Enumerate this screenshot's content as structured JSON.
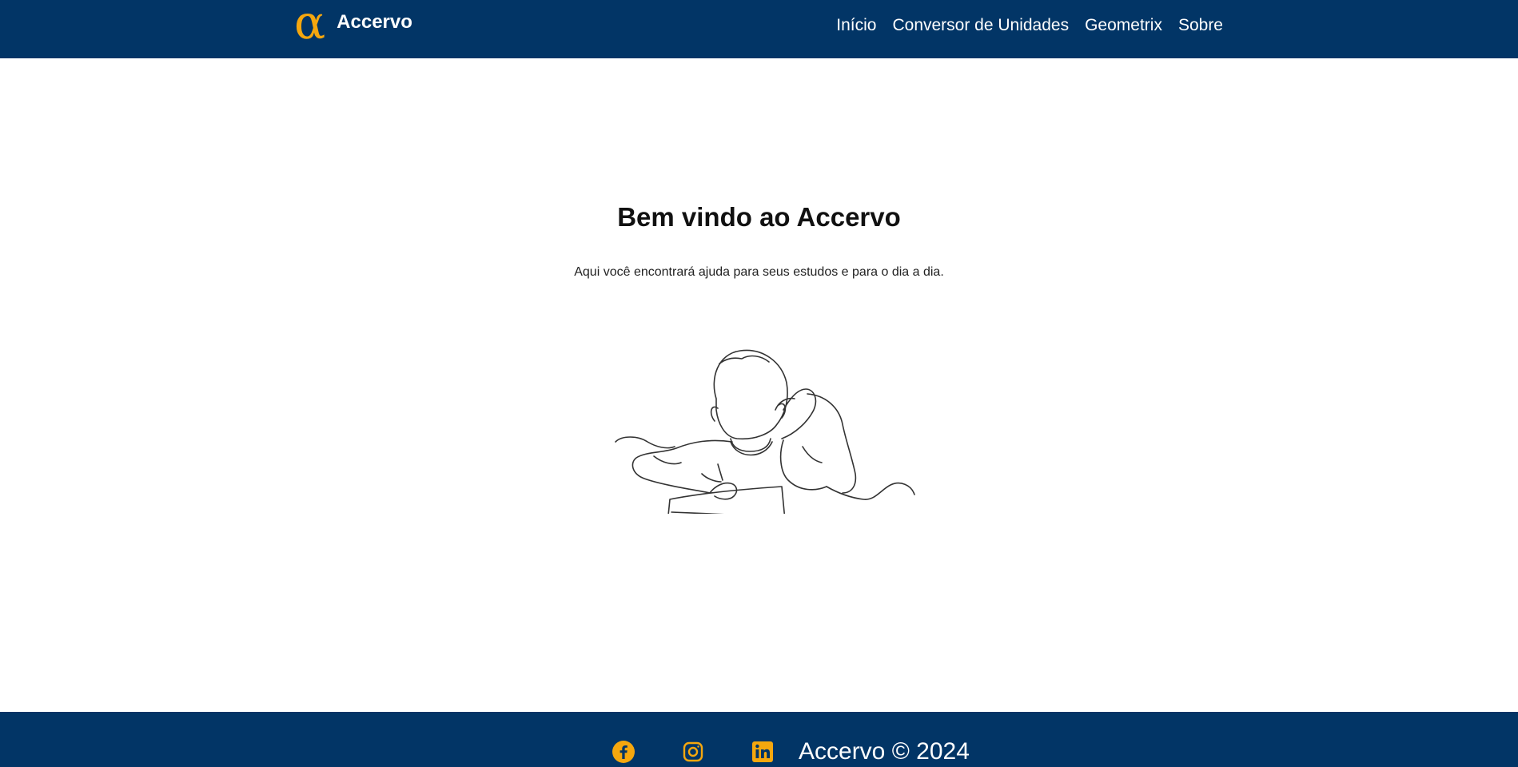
{
  "brand": {
    "logo_glyph": "α",
    "name": "Accervo",
    "accent_color": "#f5a70e",
    "bar_color": "#023566"
  },
  "nav": {
    "items": [
      {
        "label": "Início"
      },
      {
        "label": "Conversor de Unidades"
      },
      {
        "label": "Geometrix"
      },
      {
        "label": "Sobre"
      }
    ]
  },
  "hero": {
    "title": "Bem vindo ao Accervo",
    "subtitle": "Aqui você encontrará ajuda para seus estudos e para o dia a dia.",
    "illustration_icon": "student-studying-line-drawing"
  },
  "footer": {
    "social": [
      {
        "icon": "facebook-icon"
      },
      {
        "icon": "instagram-icon"
      },
      {
        "icon": "linkedin-icon"
      }
    ],
    "copyright": "Accervo © 2024"
  }
}
